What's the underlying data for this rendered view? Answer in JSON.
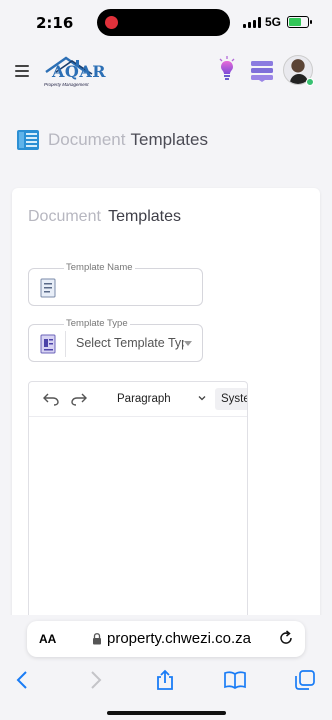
{
  "status_bar": {
    "time": "2:16",
    "network": "5G",
    "battery_color": "#33c759"
  },
  "header": {
    "logo_text": "AQAR",
    "logo_subtext": "Property Management",
    "brand_color": "#2c6fb5",
    "icons": [
      "menu-icon",
      "lightbulb-icon",
      "layers-icon",
      "avatar"
    ]
  },
  "page": {
    "title_light": "Document",
    "title_dark": "Templates"
  },
  "card": {
    "title_light": "Document",
    "title_dark": "Templates",
    "template_name": {
      "label": "Template Name",
      "value": ""
    },
    "template_type": {
      "label": "Template Type",
      "selected": "Select Template Type"
    }
  },
  "editor": {
    "block_format": "Paragraph",
    "font_family": "System Font"
  },
  "browser": {
    "text_size_label": "AA",
    "url": "property.chwezi.co.za"
  }
}
